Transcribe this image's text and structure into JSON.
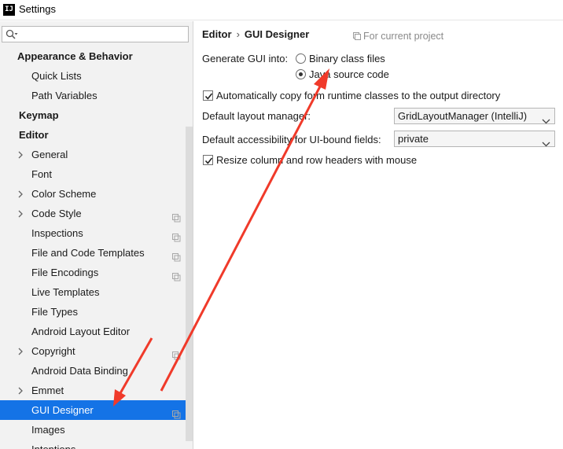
{
  "window": {
    "logo_text": "IJ",
    "title": "Settings"
  },
  "sidebar": {
    "search_placeholder": "",
    "items": [
      {
        "label": "Appearance & Behavior",
        "level": 0,
        "header": true
      },
      {
        "label": "Quick Lists",
        "level": 1
      },
      {
        "label": "Path Variables",
        "level": 1
      },
      {
        "label": "Keymap",
        "level": 0,
        "header": true
      },
      {
        "label": "Editor",
        "level": 0,
        "header": true,
        "expanded": true
      },
      {
        "label": "General",
        "level": 1,
        "chevron": true
      },
      {
        "label": "Font",
        "level": 1
      },
      {
        "label": "Color Scheme",
        "level": 1,
        "chevron": true
      },
      {
        "label": "Code Style",
        "level": 1,
        "chevron": true,
        "project": true
      },
      {
        "label": "Inspections",
        "level": 1,
        "project": true
      },
      {
        "label": "File and Code Templates",
        "level": 1,
        "project": true
      },
      {
        "label": "File Encodings",
        "level": 1,
        "project": true
      },
      {
        "label": "Live Templates",
        "level": 1
      },
      {
        "label": "File Types",
        "level": 1
      },
      {
        "label": "Android Layout Editor",
        "level": 1
      },
      {
        "label": "Copyright",
        "level": 1,
        "chevron": true,
        "project": true
      },
      {
        "label": "Android Data Binding",
        "level": 1
      },
      {
        "label": "Emmet",
        "level": 1,
        "chevron": true
      },
      {
        "label": "GUI Designer",
        "level": 1,
        "selected": true,
        "project": true
      },
      {
        "label": "Images",
        "level": 1
      },
      {
        "label": "Intentions",
        "level": 1
      }
    ]
  },
  "main": {
    "breadcrumb": [
      "Editor",
      "GUI Designer"
    ],
    "breadcrumb_sep": "›",
    "current_project": "For current project",
    "generate_label": "Generate GUI into:",
    "radio_binary": "Binary class files",
    "radio_java": "Java source code",
    "selected_radio": "Java source code",
    "checkbox_copy": "Automatically copy form runtime classes to the output directory",
    "checkbox_copy_checked": true,
    "layout_label": "Default layout manager:",
    "layout_value": "GridLayoutManager (IntelliJ)",
    "accessibility_label": "Default accessibility for UI-bound fields:",
    "accessibility_value": "private",
    "checkbox_resize": "Resize column and row headers with mouse",
    "checkbox_resize_checked": true
  },
  "colors": {
    "selection": "#1473e6",
    "annotation_arrow": "#f03a2a",
    "sidebar_bg": "#f2f2f2"
  }
}
